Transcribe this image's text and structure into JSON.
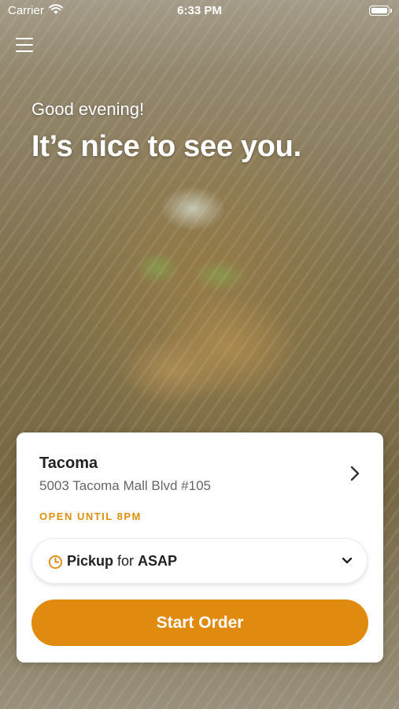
{
  "status_bar": {
    "carrier": "Carrier",
    "time": "6:33 PM"
  },
  "hero": {
    "greeting": "Good evening!",
    "headline": "It’s nice to see you."
  },
  "store": {
    "name": "Tacoma",
    "address": "5003 Tacoma Mall Blvd #105",
    "hours": "OPEN UNTIL 8PM"
  },
  "order_mode": {
    "mode": "Pickup",
    "joiner": "for",
    "time": "ASAP"
  },
  "actions": {
    "start_order": "Start Order"
  },
  "colors": {
    "accent": "#e08b10",
    "hours_text": "#e0900e"
  },
  "icons": [
    "menu-icon",
    "wifi-icon",
    "battery-icon",
    "chevron-right-icon",
    "clock-icon",
    "chevron-down-icon"
  ]
}
